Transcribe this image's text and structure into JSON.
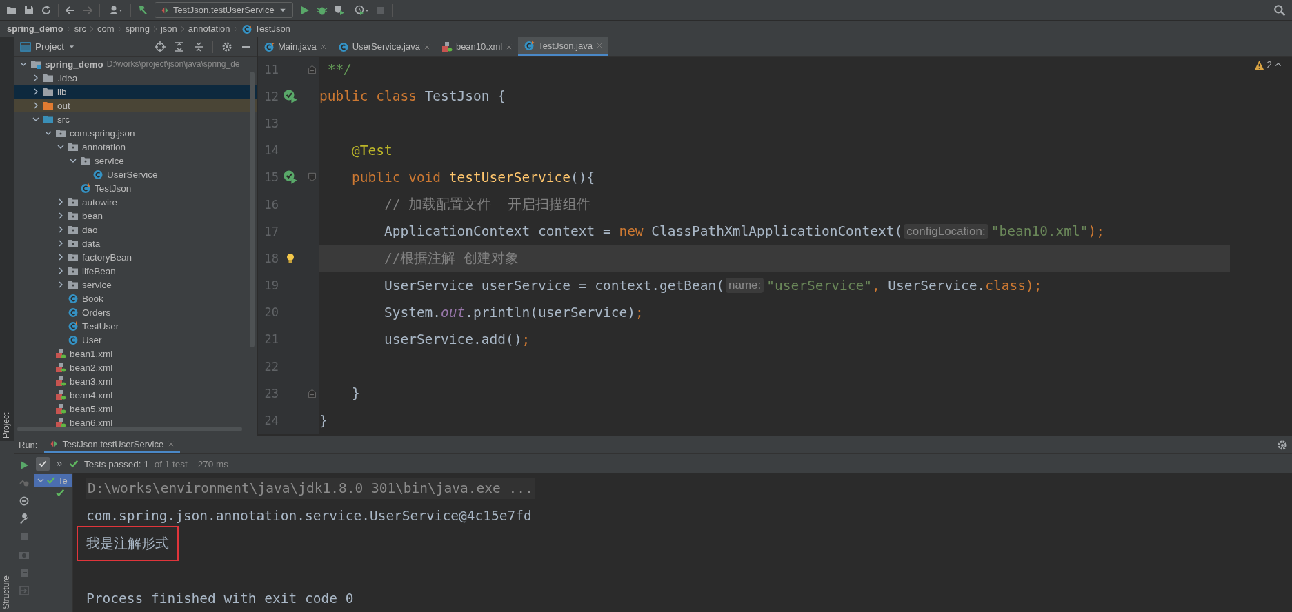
{
  "toolbar": {
    "run_config": "TestJson.testUserService"
  },
  "breadcrumb": [
    {
      "label": "spring_demo",
      "kind": "project"
    },
    {
      "label": "src",
      "kind": "dir"
    },
    {
      "label": "com",
      "kind": "dir"
    },
    {
      "label": "spring",
      "kind": "dir"
    },
    {
      "label": "json",
      "kind": "dir"
    },
    {
      "label": "annotation",
      "kind": "dir"
    },
    {
      "label": "TestJson",
      "kind": "test-class"
    }
  ],
  "side_tabs": {
    "top": "Project",
    "bottom": "Structure"
  },
  "project_panel": {
    "title": "Project",
    "tree": [
      {
        "label": "spring_demo",
        "kind": "module",
        "path": "D:\\works\\project\\json\\java\\spring_de",
        "expanded": true,
        "selected": false,
        "children": [
          {
            "label": ".idea",
            "kind": "folder",
            "expanded": false,
            "selected": false
          },
          {
            "label": "lib",
            "kind": "folder",
            "expanded": false,
            "selected": true
          },
          {
            "label": "out",
            "kind": "excluded",
            "expanded": false,
            "selected": false
          },
          {
            "label": "src",
            "kind": "source",
            "expanded": true,
            "selected": false,
            "children": [
              {
                "label": "com.spring.json",
                "kind": "package",
                "expanded": true,
                "selected": false,
                "children": [
                  {
                    "label": "annotation",
                    "kind": "package",
                    "expanded": true,
                    "selected": false,
                    "children": [
                      {
                        "label": "service",
                        "kind": "package",
                        "expanded": true,
                        "selected": false,
                        "children": [
                          {
                            "label": "UserService",
                            "kind": "class",
                            "selected": false
                          }
                        ]
                      },
                      {
                        "label": "TestJson",
                        "kind": "test-class",
                        "selected": false
                      }
                    ]
                  },
                  {
                    "label": "autowire",
                    "kind": "package",
                    "expanded": false,
                    "selected": false
                  },
                  {
                    "label": "bean",
                    "kind": "package",
                    "expanded": false,
                    "selected": false
                  },
                  {
                    "label": "dao",
                    "kind": "package",
                    "expanded": false,
                    "selected": false
                  },
                  {
                    "label": "data",
                    "kind": "package",
                    "expanded": false,
                    "selected": false
                  },
                  {
                    "label": "factoryBean",
                    "kind": "package",
                    "expanded": false,
                    "selected": false
                  },
                  {
                    "label": "lifeBean",
                    "kind": "package",
                    "expanded": false,
                    "selected": false
                  },
                  {
                    "label": "service",
                    "kind": "package",
                    "expanded": false,
                    "selected": false
                  },
                  {
                    "label": "Book",
                    "kind": "class",
                    "selected": false
                  },
                  {
                    "label": "Orders",
                    "kind": "class",
                    "selected": false
                  },
                  {
                    "label": "TestUser",
                    "kind": "test-class",
                    "selected": false
                  },
                  {
                    "label": "User",
                    "kind": "class",
                    "selected": false
                  }
                ]
              },
              {
                "label": "bean1.xml",
                "kind": "xml",
                "selected": false
              },
              {
                "label": "bean2.xml",
                "kind": "xml",
                "selected": false
              },
              {
                "label": "bean3.xml",
                "kind": "xml",
                "selected": false
              },
              {
                "label": "bean4.xml",
                "kind": "xml",
                "selected": false
              },
              {
                "label": "bean5.xml",
                "kind": "xml",
                "selected": false
              },
              {
                "label": "bean6.xml",
                "kind": "xml",
                "selected": false
              }
            ]
          }
        ]
      }
    ]
  },
  "editor": {
    "tabs": [
      {
        "label": "Main.java",
        "kind": "test-class",
        "selected": false
      },
      {
        "label": "UserService.java",
        "kind": "class",
        "selected": false
      },
      {
        "label": "bean10.xml",
        "kind": "xml",
        "selected": false
      },
      {
        "label": "TestJson.java",
        "kind": "test-class",
        "selected": true
      }
    ],
    "warnings": "2",
    "lines": [
      {
        "number": "11",
        "fold_end": true,
        "current": false,
        "tokens": [
          {
            "text": " **/",
            "kind": "doc"
          }
        ]
      },
      {
        "number": "12",
        "run_icon": true,
        "current": false,
        "tokens": [
          {
            "text": "public class ",
            "kind": "keyword"
          },
          {
            "text": "TestJson {",
            "kind": "plain"
          }
        ]
      },
      {
        "number": "13",
        "current": false
      },
      {
        "number": "14",
        "current": false,
        "tokens": [
          {
            "text": "    @Test",
            "kind": "annotation"
          }
        ]
      },
      {
        "number": "15",
        "run_icon": true,
        "fold_start": true,
        "current": false,
        "tokens": [
          {
            "text": "    public void ",
            "kind": "keyword"
          },
          {
            "text": "testUserService",
            "kind": "method"
          },
          {
            "text": "(){",
            "kind": "plain"
          }
        ]
      },
      {
        "number": "16",
        "current": false,
        "tokens": [
          {
            "text": "        // 加载配置文件  开启扫描组件",
            "kind": "comment"
          }
        ]
      },
      {
        "number": "17",
        "current": false,
        "tokens": [
          {
            "text": "        ApplicationContext context = ",
            "kind": "plain"
          },
          {
            "text": "new ",
            "kind": "keyword"
          },
          {
            "text": "ClassPathXmlApplicationContext(",
            "kind": "plain"
          },
          {
            "text": "configLocation:",
            "kind": "hint"
          },
          {
            "text": "\"bean10.xml\"",
            "kind": "string"
          },
          {
            "text": ");",
            "kind": "keyword"
          }
        ]
      },
      {
        "number": "18",
        "bulb": true,
        "current": true,
        "tokens": [
          {
            "text": "        //根据注解 创建对象",
            "kind": "comment"
          }
        ]
      },
      {
        "number": "19",
        "current": false,
        "tokens": [
          {
            "text": "        UserService userService = context.getBean(",
            "kind": "plain"
          },
          {
            "text": "name:",
            "kind": "hint"
          },
          {
            "text": "\"userService\"",
            "kind": "string"
          },
          {
            "text": ", ",
            "kind": "keyword"
          },
          {
            "text": "UserService.",
            "kind": "plain"
          },
          {
            "text": "class",
            "kind": "keyword"
          },
          {
            "text": ");",
            "kind": "keyword"
          }
        ]
      },
      {
        "number": "20",
        "current": false,
        "tokens": [
          {
            "text": "        System.",
            "kind": "plain"
          },
          {
            "text": "out",
            "kind": "field"
          },
          {
            "text": ".println(userService)",
            "kind": "plain"
          },
          {
            "text": ";",
            "kind": "keyword"
          }
        ]
      },
      {
        "number": "21",
        "current": false,
        "tokens": [
          {
            "text": "        userService.add()",
            "kind": "plain"
          },
          {
            "text": ";",
            "kind": "keyword"
          }
        ]
      },
      {
        "number": "22",
        "current": false
      },
      {
        "number": "23",
        "fold_end": true,
        "current": false,
        "tokens": [
          {
            "text": "    }",
            "kind": "plain"
          }
        ]
      },
      {
        "number": "24",
        "current": false,
        "tokens": [
          {
            "text": "}",
            "kind": "plain"
          }
        ]
      }
    ]
  },
  "run_panel": {
    "label": "Run:",
    "tab": "TestJson.testUserService",
    "status": "Tests passed: 1",
    "status_detail": "of 1 test – 270 ms",
    "tests": [
      {
        "label": "Te",
        "passed": true,
        "selected": true,
        "expanded": true,
        "children": [
          {
            "passed": true,
            "selected": false
          }
        ]
      }
    ],
    "console": [
      {
        "kind": "command",
        "text": "D:\\works\\environment\\java\\jdk1.8.0_301\\bin\\java.exe ...",
        "boxed": false
      },
      {
        "kind": "output",
        "text": "com.spring.json.annotation.service.UserService@4c15e7fd",
        "boxed": false
      },
      {
        "kind": "output",
        "text": "我是注解形式",
        "boxed": true
      },
      {
        "kind": "blank"
      },
      {
        "kind": "output",
        "text": "Process finished with exit code 0",
        "boxed": false
      }
    ]
  }
}
